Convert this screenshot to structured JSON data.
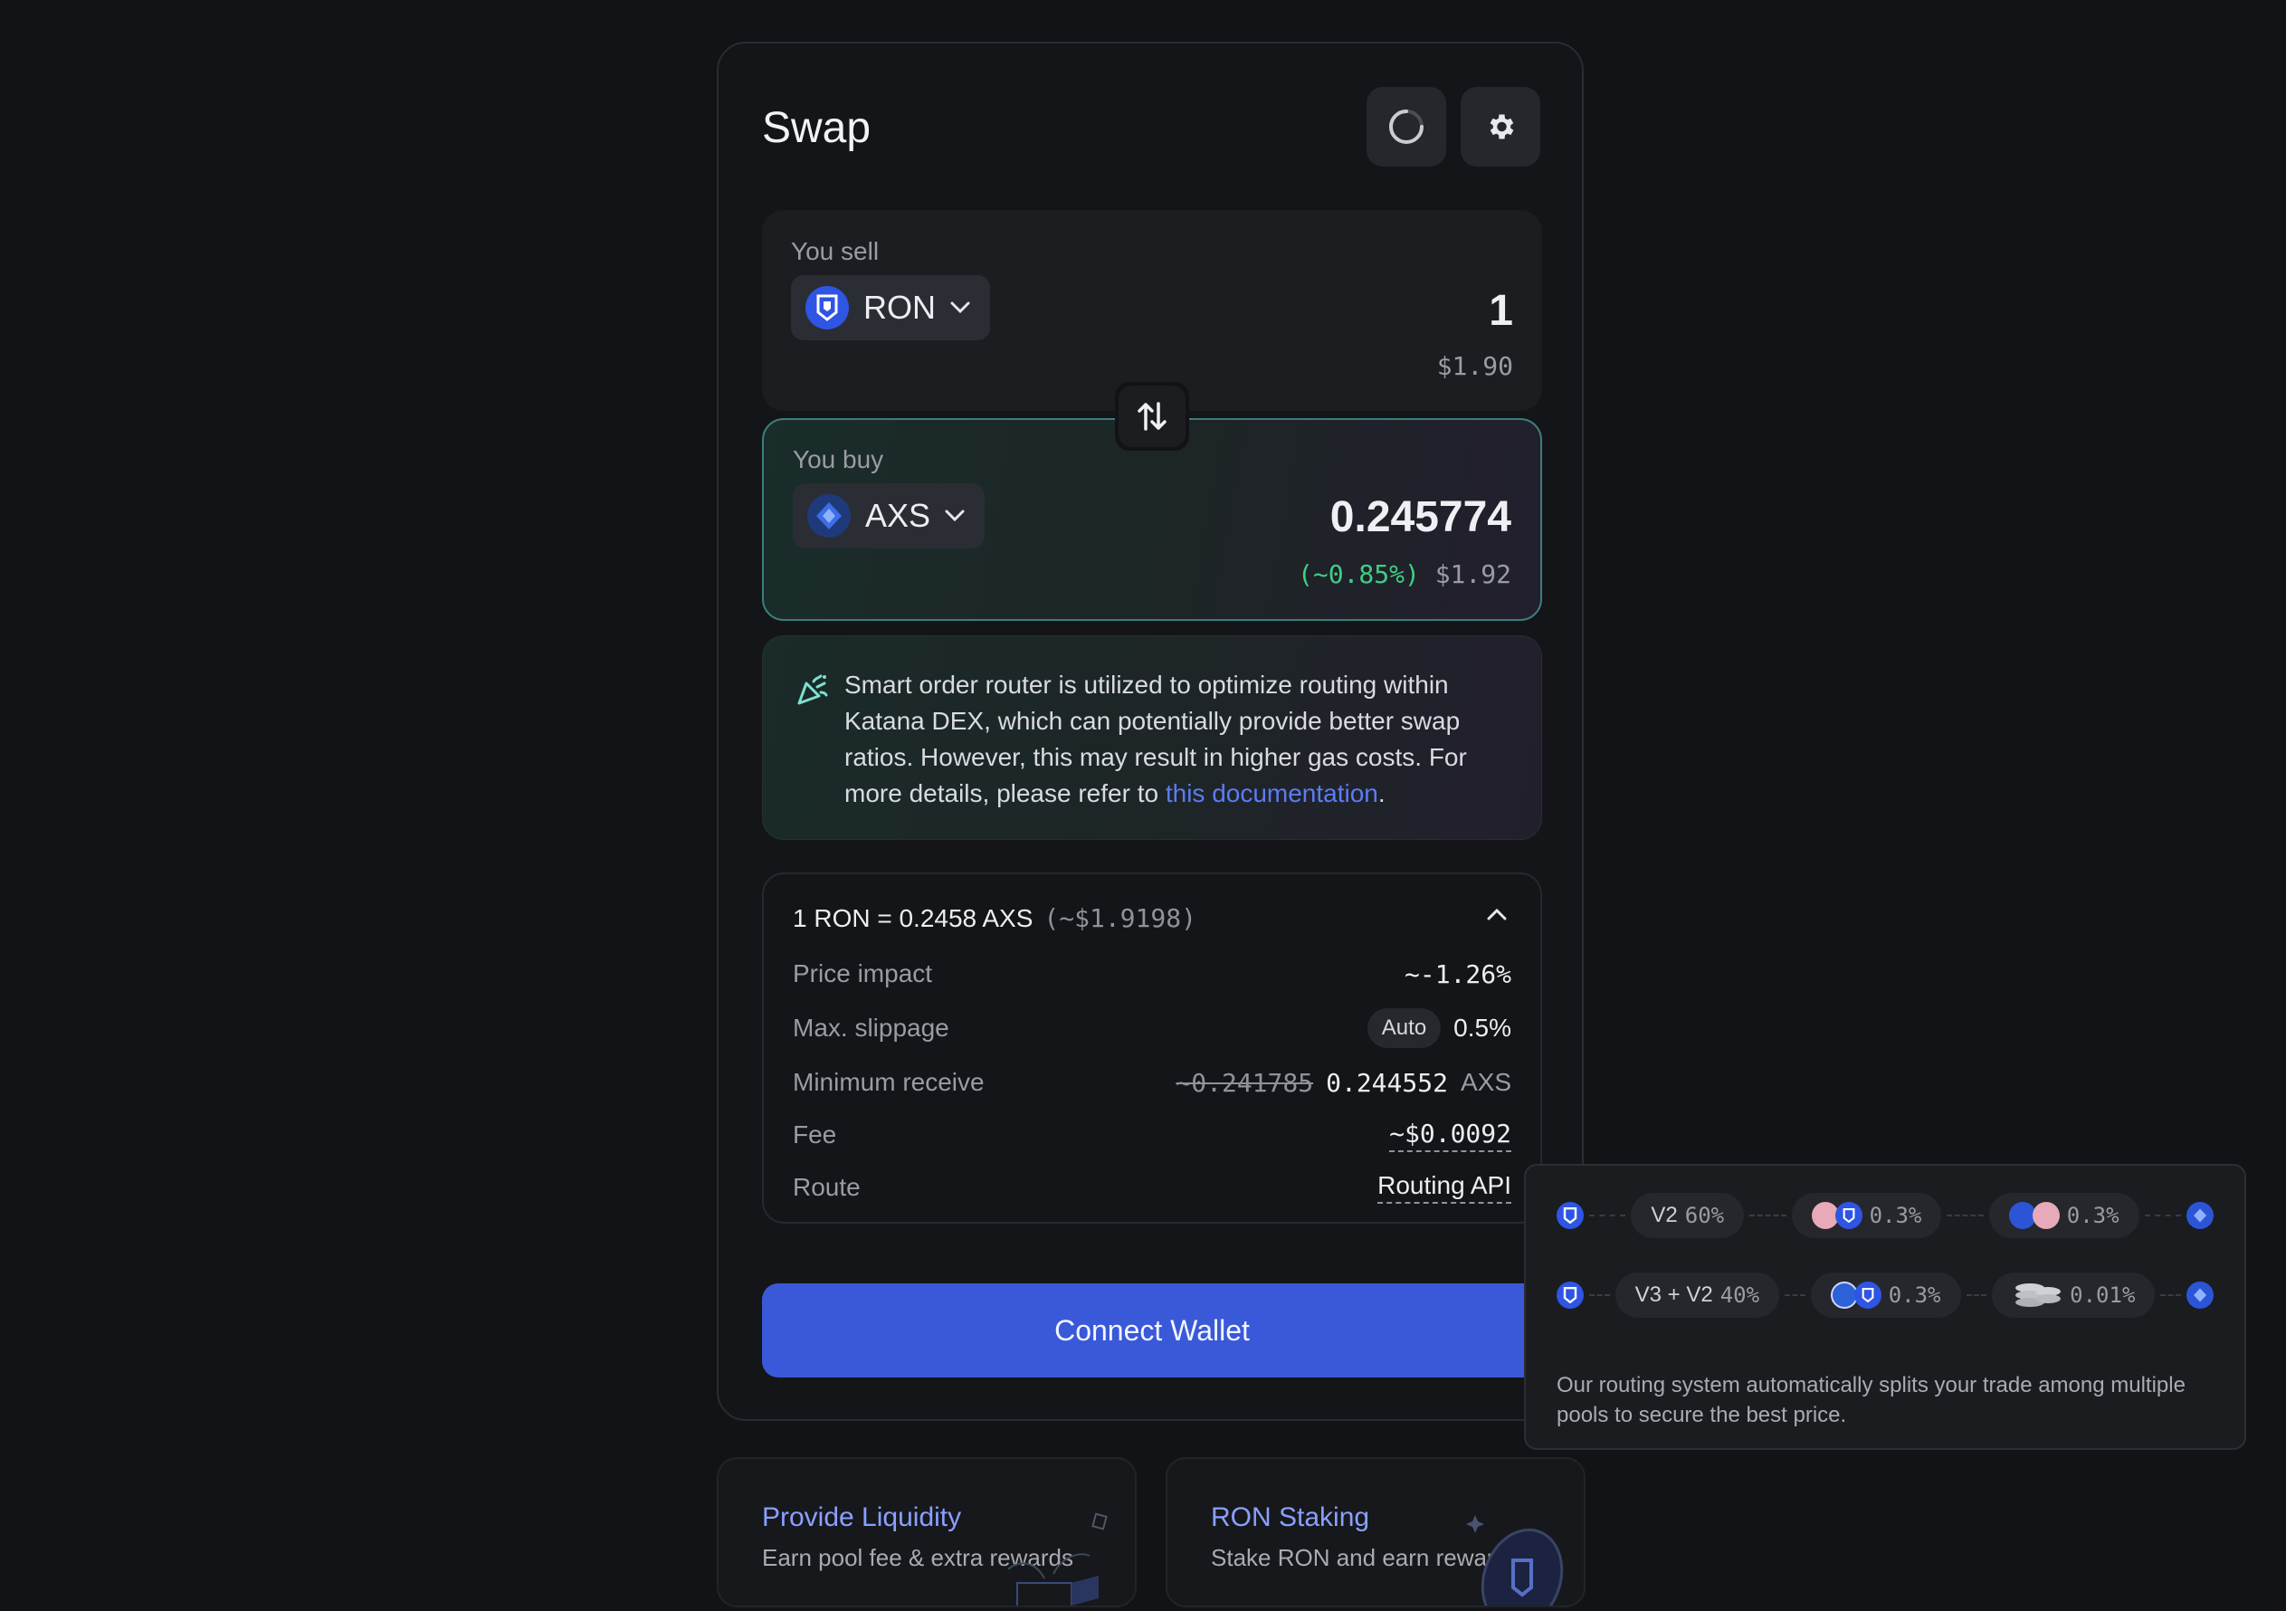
{
  "swap": {
    "title": "Swap",
    "sell": {
      "label": "You sell",
      "token": "RON",
      "amount": "1",
      "usd": "$1.90"
    },
    "buy": {
      "label": "You buy",
      "token": "AXS",
      "amount": "0.245774",
      "diff": "(~0.85%)",
      "usd": "$1.92"
    },
    "info": {
      "text": "Smart order router is utilized to optimize routing within Katana DEX, which can potentially provide better swap ratios. However, this may result in higher gas costs. For more details, please refer to ",
      "link": "this documentation",
      "end": "."
    },
    "details": {
      "rate": "1 RON = 0.2458 AXS",
      "rate_usd": "(~$1.9198)",
      "price_impact_label": "Price impact",
      "price_impact": "~-1.26%",
      "slippage_label": "Max. slippage",
      "slippage_badge": "Auto",
      "slippage": "0.5%",
      "min_receive_label": "Minimum receive",
      "min_receive_old": "~0.241785",
      "min_receive": "0.244552",
      "min_receive_unit": "AXS",
      "fee_label": "Fee",
      "fee": "~$0.0092",
      "route_label": "Route",
      "route": "Routing API"
    },
    "connect_label": "Connect Wallet"
  },
  "route_popup": {
    "routes": [
      {
        "name": "V2",
        "pct": "60%",
        "hop1": "0.3%",
        "hop2": "0.3%"
      },
      {
        "name": "V3 + V2",
        "pct": "40%",
        "hop1": "0.3%",
        "hop2": "0.01%"
      }
    ],
    "note": "Our routing system automatically splits your trade among multiple pools to secure the best price."
  },
  "promos": [
    {
      "title": "Provide Liquidity",
      "subtitle": "Earn pool fee & extra rewards"
    },
    {
      "title": "RON Staking",
      "subtitle": "Stake RON and earn rewards"
    }
  ],
  "colors": {
    "accent": "#3959d8",
    "ron": "#2f55e4",
    "positive": "#3ecf83",
    "warning": "#f0a23b",
    "link": "#5b7cf5"
  },
  "icons": [
    "refresh-icon",
    "gear-icon",
    "ron-token-icon",
    "axs-token-icon",
    "chevron-down-icon",
    "swap-arrows-icon",
    "party-popper-icon",
    "chevron-up-icon"
  ]
}
